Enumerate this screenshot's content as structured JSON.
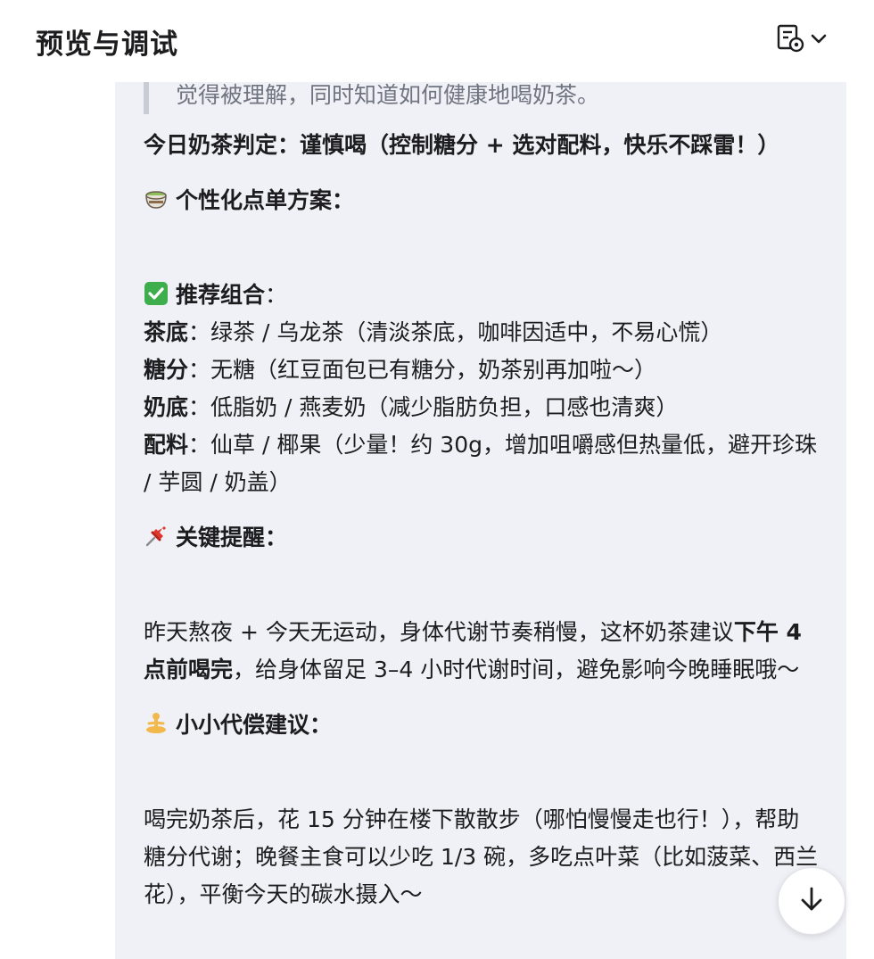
{
  "header": {
    "title": "预览与调试",
    "doc_icon": "doc-settings-icon",
    "dropdown_icon": "chevron-down-icon"
  },
  "quote": {
    "text": "觉得被理解，同时知道如何健康地喝奶茶。"
  },
  "verdict": {
    "text": "今日奶茶判定：谨慎喝（控制糖分 + 选对配料，快乐不踩雷！）"
  },
  "plan": {
    "icon": "tea-cup-icon",
    "heading": "个性化点单方案："
  },
  "recommend": {
    "icon": "check-mark-icon",
    "heading": "推荐组合",
    "colon": "：",
    "items": [
      {
        "label": "茶底",
        "sep": "：",
        "text": "绿茶 / 乌龙茶（清淡茶底，咖啡因适中，不易心慌）"
      },
      {
        "label": "糖分",
        "sep": "：",
        "text": "无糖（红豆面包已有糖分，奶茶别再加啦～）"
      },
      {
        "label": "奶底",
        "sep": "：",
        "text": "低脂奶 / 燕麦奶（减少脂肪负担，口感也清爽）"
      },
      {
        "label": "配料",
        "sep": "：",
        "text": "仙草 / 椰果（少量！约 30g，增加咀嚼感但热量低，避开珍珠 / 芋圆 / 奶盖）"
      }
    ]
  },
  "reminder": {
    "icon": "pushpin-icon",
    "heading": "关键提醒：",
    "text_before": "昨天熬夜 + 今天无运动，身体代谢节奏稍慢，这杯奶茶建议",
    "text_bold": "下午 4 点前喝完",
    "text_after": "，给身体留足 3–4 小时代谢时间，避免影响今晚睡眠哦～"
  },
  "compensate": {
    "icon": "meditation-person-icon",
    "heading": "小小代偿建议：",
    "text": "喝完奶茶后，花 15 分钟在楼下散散步（哪怕慢慢走也行！），帮助糖分代谢；晚餐主食可以少吃 1/3 碗，多吃点叶菜（比如菠菜、西兰花），平衡今天的碳水摄入～"
  },
  "scroll_button": {
    "icon": "arrow-down-icon"
  }
}
